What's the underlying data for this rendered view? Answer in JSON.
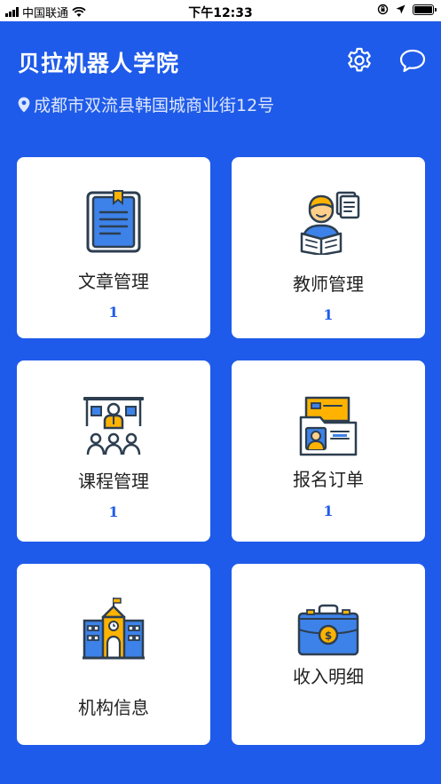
{
  "status_bar": {
    "carrier": "中国联通",
    "time": "下午12:33"
  },
  "header": {
    "title": "贝拉机器人学院",
    "address": "成都市双流县韩国城商业街12号",
    "settings_icon": "gear-icon",
    "message_icon": "chat-bubble-icon"
  },
  "theme": {
    "primary": "#1f5bea",
    "accent": "#ffb300",
    "icon_stroke": "#2d3e50"
  },
  "cards": [
    {
      "label": "文章管理",
      "count": "1",
      "icon": "article-book-icon"
    },
    {
      "label": "教师管理",
      "count": "1",
      "icon": "teacher-reading-icon"
    },
    {
      "label": "课程管理",
      "count": "1",
      "icon": "classroom-icon"
    },
    {
      "label": "报名订单",
      "count": "1",
      "icon": "registration-folder-icon"
    },
    {
      "label": "机构信息",
      "icon": "school-building-icon"
    },
    {
      "label": "收入明细",
      "icon": "money-briefcase-icon"
    }
  ]
}
